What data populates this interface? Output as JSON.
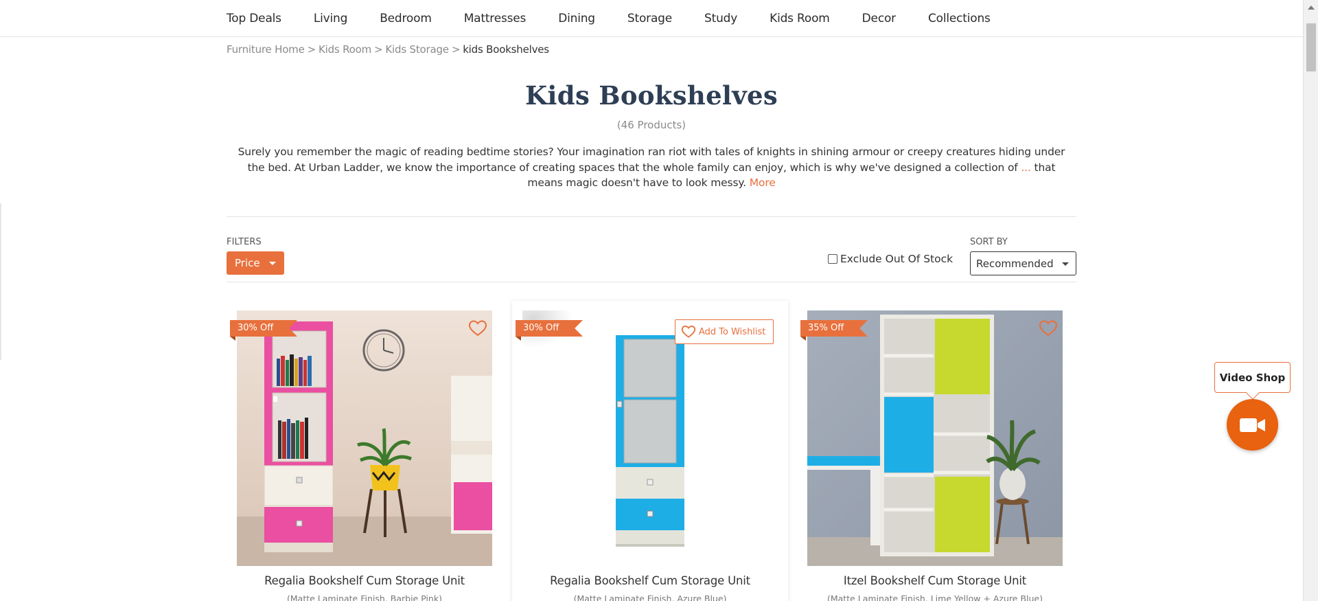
{
  "nav": {
    "items": [
      "Top Deals",
      "Living",
      "Bedroom",
      "Mattresses",
      "Dining",
      "Storage",
      "Study",
      "Kids Room",
      "Decor",
      "Collections"
    ]
  },
  "breadcrumb": {
    "items": [
      "Furniture Home",
      "Kids Room",
      "Kids Storage"
    ],
    "separator": ">",
    "current": "kids Bookshelves"
  },
  "header": {
    "title": "Kids Bookshelves",
    "count": "(46 Products)",
    "description": "Surely you remember the magic of reading bedtime stories? Your imagination ran riot with tales of knights in shining armour or creepy creatures hiding under the bed. At Urban Ladder, we know the importance of creating spaces that the whole family can enjoy, which is why we've designed a collection of",
    "ellipsis": "...",
    "description_end": "that means magic doesn't have to look messy.",
    "more_label": "More"
  },
  "filters": {
    "label": "FILTERS",
    "price_label": "Price",
    "exclude_label": "Exclude Out Of Stock",
    "exclude_checked": false,
    "sort_label": "SORT BY",
    "sort_value": "Recommended"
  },
  "products": [
    {
      "name": "Regalia Bookshelf Cum Storage Unit",
      "sub": "(Matte Laminate Finish, Barbie Pink)",
      "discount": "30% Off"
    },
    {
      "name": "Regalia Bookshelf Cum Storage Unit",
      "sub": "(Matte Laminate Finish, Azure Blue)",
      "discount": "30% Off",
      "wishlist_label": "Add To Wishlist"
    },
    {
      "name": "Itzel Bookshelf Cum Storage Unit",
      "sub": "(Matte Laminate Finish, Lime Yellow + Azure Blue)",
      "discount": "35% Off"
    }
  ],
  "video_shop": {
    "label": "Video Shop"
  },
  "colors": {
    "accent": "#e8703d",
    "title": "#2e3e55",
    "pink": "#f04fa8",
    "blue": "#1eaee6",
    "lime": "#c7d92e"
  }
}
